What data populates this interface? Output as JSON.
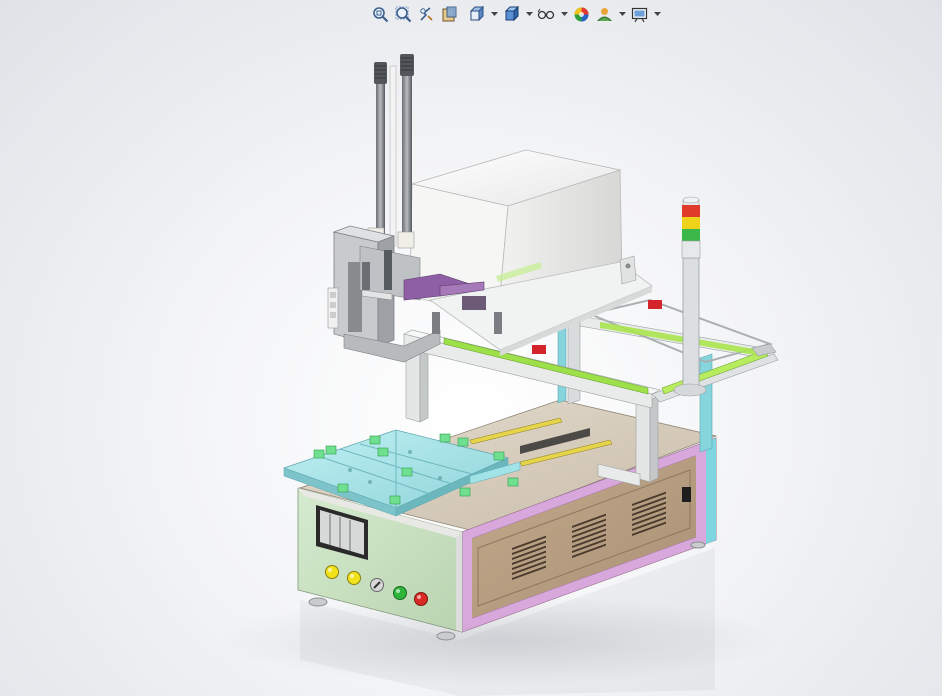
{
  "viewport": {
    "description_label": "",
    "background_top": "#f6f7f8",
    "background_edge": "#dfe2e7"
  },
  "toolbar": {
    "tools": [
      {
        "name": "zoom-to-fit-icon",
        "has_menu": false
      },
      {
        "name": "zoom-to-area-icon",
        "has_menu": false
      },
      {
        "name": "previous-view-icon",
        "has_menu": false
      },
      {
        "name": "section-view-icon",
        "has_menu": false
      },
      {
        "name": "view-orientation-icon",
        "has_menu": true
      },
      {
        "name": "display-style-icon",
        "has_menu": true
      },
      {
        "name": "hide-show-items-icon",
        "has_menu": true
      },
      {
        "name": "edit-appearance-icon",
        "has_menu": false
      },
      {
        "name": "apply-scene-icon",
        "has_menu": true
      },
      {
        "name": "view-settings-icon",
        "has_menu": true
      }
    ]
  },
  "model": {
    "stack_light_colors": [
      "#e03a2a",
      "#f1d21a",
      "#3cb84a"
    ],
    "button_colors": [
      "#f2e21c",
      "#f2e21c",
      "#d8d8d8",
      "#2fb53a",
      "#d92b25"
    ],
    "accent_colors": {
      "fixture": "#a7e6ea",
      "clamp": "#6fe08f",
      "panel_front": "#cfe5c6",
      "panel_side": "#b59c82",
      "trim": "#d7a6dc",
      "cover": "#f4f4f2",
      "frame": "#d9dcdc",
      "slider": "#c23b8a"
    }
  }
}
